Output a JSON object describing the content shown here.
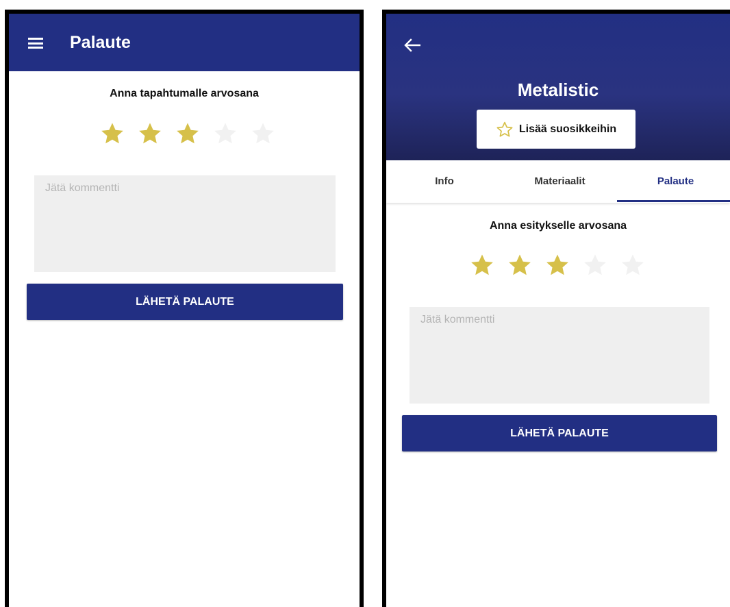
{
  "colors": {
    "primary": "#222f83",
    "star_filled": "#d6c04a",
    "star_empty": "#f1f1f1",
    "comment_bg": "#efefef"
  },
  "left_screen": {
    "appbar": {
      "menu_icon": "hamburger-menu-icon",
      "title": "Palaute"
    },
    "rating_title": "Anna tapahtumalle arvosana",
    "rating": {
      "value": 3,
      "max": 5
    },
    "comment_placeholder": "Jätä kommentti",
    "submit_label": "LÄHETÄ PALAUTE"
  },
  "right_screen": {
    "header": {
      "back_icon": "arrow-left-icon",
      "title": "Metalistic",
      "favorite_icon": "star-outline-icon",
      "favorite_label": "Lisää suosikkeihin"
    },
    "tabs": [
      {
        "label": "Info",
        "active": false
      },
      {
        "label": "Materiaalit",
        "active": false
      },
      {
        "label": "Palaute",
        "active": true
      }
    ],
    "rating_title": "Anna esitykselle arvosana",
    "rating": {
      "value": 3,
      "max": 5
    },
    "comment_placeholder": "Jätä kommentti",
    "submit_label": "LÄHETÄ PALAUTE"
  }
}
